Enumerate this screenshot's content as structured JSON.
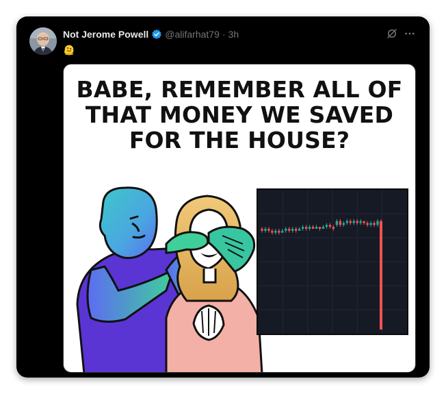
{
  "tweet": {
    "display_name": "Not Jerome Powell",
    "handle": "@alifarhat79",
    "separator": "·",
    "time": "3h",
    "text": "🫠",
    "verified": true
  },
  "meme": {
    "headline_lines": [
      "BABE, REMEMBER ALL OF",
      "THAT MONEY WE SAVED",
      "FOR THE HOUSE?"
    ]
  },
  "colors": {
    "card_bg": "#000000",
    "verified_blue": "#1d9bf0",
    "candle_up": "#26a69a",
    "candle_down": "#ef5350",
    "chart_bg": "#161a25"
  },
  "icons": {
    "verified": "verified-badge-icon",
    "grok": "grok-icon",
    "more": "more-icon"
  },
  "chart_data": {
    "type": "candlestick",
    "title": "",
    "xlabel": "",
    "ylabel": "",
    "grid": true,
    "candles": [
      {
        "o": 52,
        "c": 51,
        "h": 53,
        "l": 50
      },
      {
        "o": 51,
        "c": 52,
        "h": 53,
        "l": 50
      },
      {
        "o": 52,
        "c": 51,
        "h": 53,
        "l": 50
      },
      {
        "o": 51,
        "c": 50,
        "h": 52,
        "l": 49
      },
      {
        "o": 50,
        "c": 51,
        "h": 52,
        "l": 49
      },
      {
        "o": 51,
        "c": 50,
        "h": 52,
        "l": 49
      },
      {
        "o": 50,
        "c": 51,
        "h": 52,
        "l": 50
      },
      {
        "o": 51,
        "c": 52,
        "h": 53,
        "l": 50
      },
      {
        "o": 52,
        "c": 51,
        "h": 53,
        "l": 50
      },
      {
        "o": 51,
        "c": 52,
        "h": 53,
        "l": 50
      },
      {
        "o": 52,
        "c": 51,
        "h": 53,
        "l": 50
      },
      {
        "o": 51,
        "c": 52,
        "h": 53,
        "l": 51
      },
      {
        "o": 52,
        "c": 53,
        "h": 54,
        "l": 51
      },
      {
        "o": 53,
        "c": 52,
        "h": 54,
        "l": 51
      },
      {
        "o": 52,
        "c": 53,
        "h": 54,
        "l": 51
      },
      {
        "o": 53,
        "c": 52,
        "h": 54,
        "l": 52
      },
      {
        "o": 52,
        "c": 53,
        "h": 54,
        "l": 52
      },
      {
        "o": 53,
        "c": 52,
        "h": 53,
        "l": 51
      },
      {
        "o": 52,
        "c": 53,
        "h": 54,
        "l": 52
      },
      {
        "o": 53,
        "c": 54,
        "h": 55,
        "l": 52
      },
      {
        "o": 54,
        "c": 53,
        "h": 55,
        "l": 52
      },
      {
        "o": 53,
        "c": 52,
        "h": 54,
        "l": 51
      },
      {
        "o": 54,
        "c": 56,
        "h": 57,
        "l": 53
      },
      {
        "o": 56,
        "c": 54,
        "h": 57,
        "l": 53
      },
      {
        "o": 54,
        "c": 55,
        "h": 56,
        "l": 53
      },
      {
        "o": 55,
        "c": 56,
        "h": 57,
        "l": 54
      },
      {
        "o": 56,
        "c": 55,
        "h": 57,
        "l": 54
      },
      {
        "o": 55,
        "c": 56,
        "h": 57,
        "l": 54
      },
      {
        "o": 56,
        "c": 55,
        "h": 57,
        "l": 54
      },
      {
        "o": 55,
        "c": 56,
        "h": 57,
        "l": 54
      },
      {
        "o": 56,
        "c": 55,
        "h": 56,
        "l": 54
      },
      {
        "o": 55,
        "c": 54,
        "h": 56,
        "l": 53
      },
      {
        "o": 54,
        "c": 55,
        "h": 56,
        "l": 53
      },
      {
        "o": 55,
        "c": 54,
        "h": 56,
        "l": 53
      },
      {
        "o": 54,
        "c": 56,
        "h": 57,
        "l": 53
      },
      {
        "o": 56,
        "c": 0,
        "h": 57,
        "l": 0
      }
    ],
    "ylim": [
      0,
      70
    ]
  }
}
